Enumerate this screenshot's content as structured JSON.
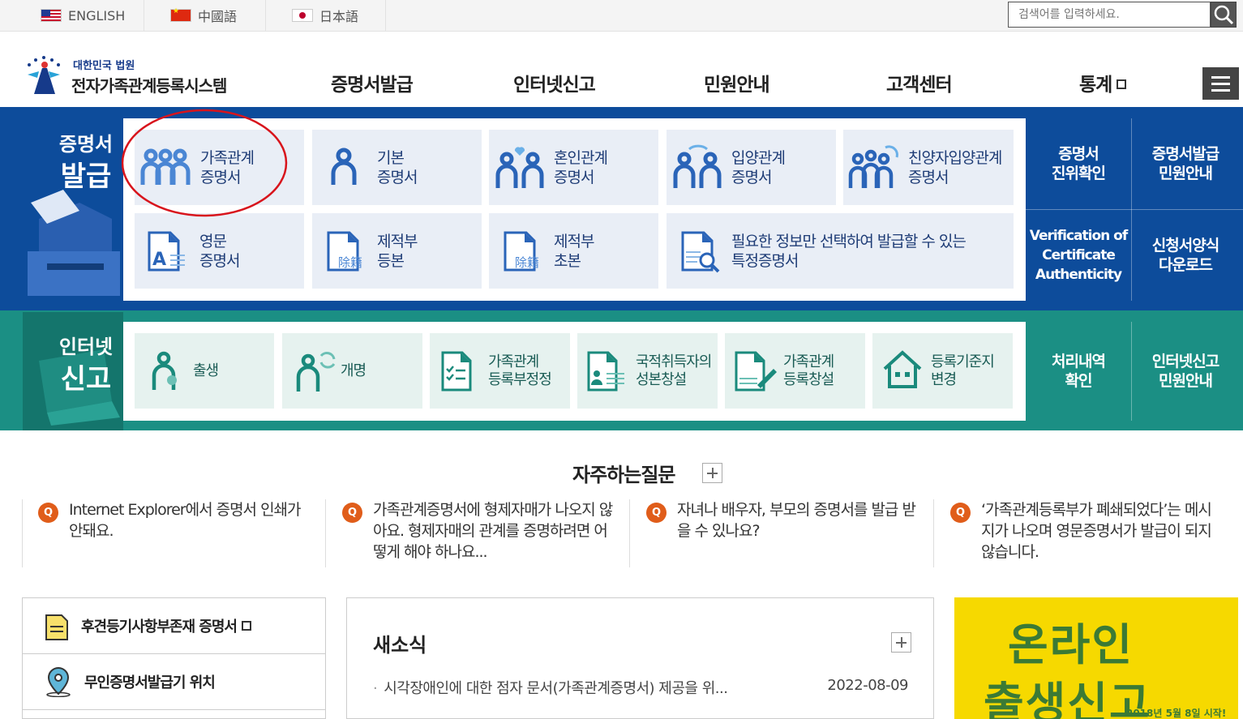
{
  "top_langs": [
    {
      "label": "ENGLISH",
      "flag": "us-flag-icon"
    },
    {
      "label": "中國語",
      "flag": "cn-flag-icon"
    },
    {
      "label": "日本語",
      "flag": "jp-flag-icon"
    }
  ],
  "search": {
    "placeholder": "검색어를 입력하세요."
  },
  "logo": {
    "sub": "대한민국 법원",
    "main": "전자가족관계등록시스템"
  },
  "nav": [
    "증명서발급",
    "인터넷신고",
    "민원안내",
    "고객센터",
    "통계"
  ],
  "issue": {
    "title_line1": "증명서",
    "title_line2": "발급",
    "tiles": [
      {
        "label": "가족관계\n증명서",
        "icon": "family-icon"
      },
      {
        "label": "기본\n증명서",
        "icon": "person-icon"
      },
      {
        "label": "혼인관계\n증명서",
        "icon": "couple-heart-icon"
      },
      {
        "label": "입양관계\n증명서",
        "icon": "adoption-icon"
      },
      {
        "label": "친양자입양관계\n증명서",
        "icon": "family-adoption-icon"
      },
      {
        "label": "영문\n증명서",
        "icon": "english-doc-icon"
      },
      {
        "label": "제적부\n등본",
        "icon": "register-copy-icon"
      },
      {
        "label": "제적부\n초본",
        "icon": "register-abstract-icon"
      },
      {
        "label": "필요한 정보만 선택하여 발급할 수 있는\n특정증명서",
        "icon": "doc-search-icon"
      }
    ],
    "side": [
      "증명서\n진위확인",
      "증명서발급\n민원안내",
      "Verification of\nCertificate\nAuthenticity",
      "신청서양식\n다운로드"
    ]
  },
  "report": {
    "title_line1": "인터넷",
    "title_line2": "신고",
    "tiles": [
      {
        "label": "출생",
        "icon": "birth-icon"
      },
      {
        "label": "개명",
        "icon": "rename-icon"
      },
      {
        "label": "가족관계\n등록부정정",
        "icon": "correction-icon"
      },
      {
        "label": "국적취득자의\n성본창설",
        "icon": "nationality-icon"
      },
      {
        "label": "가족관계\n등록창설",
        "icon": "creation-icon"
      },
      {
        "label": "등록기준지\n변경",
        "icon": "house-icon"
      }
    ],
    "side": [
      "처리내역\n확인",
      "인터넷신고\n민원안내"
    ]
  },
  "faq": {
    "title": "자주하는질문",
    "items": [
      "Internet Explorer에서 증명서 인쇄가 안돼요.",
      "가족관계증명서에 형제자매가 나오지 않아요. 형제자매의 관계를 증명하려면 어떻게 해야 하나요...",
      "자녀나 배우자, 부모의 증명서를 발급 받을 수 있나요?",
      "‘가족관계등록부가 폐쇄되었다’는 메시지가 나오며 영문증명서가 발급이 되지 않습니다."
    ]
  },
  "quick": [
    "후견등기사항부존재 증명서",
    "무인증명서발급기 위치"
  ],
  "news": {
    "title": "새소식",
    "items": [
      {
        "text": "시각장애인에 대한 점자 문서(가족관계증명서) 제공을 위...",
        "date": "2022-08-09"
      }
    ]
  },
  "banner": {
    "line1": "온라인",
    "line2": "출생신고",
    "note": "2018년 5월 8일 시작!"
  }
}
